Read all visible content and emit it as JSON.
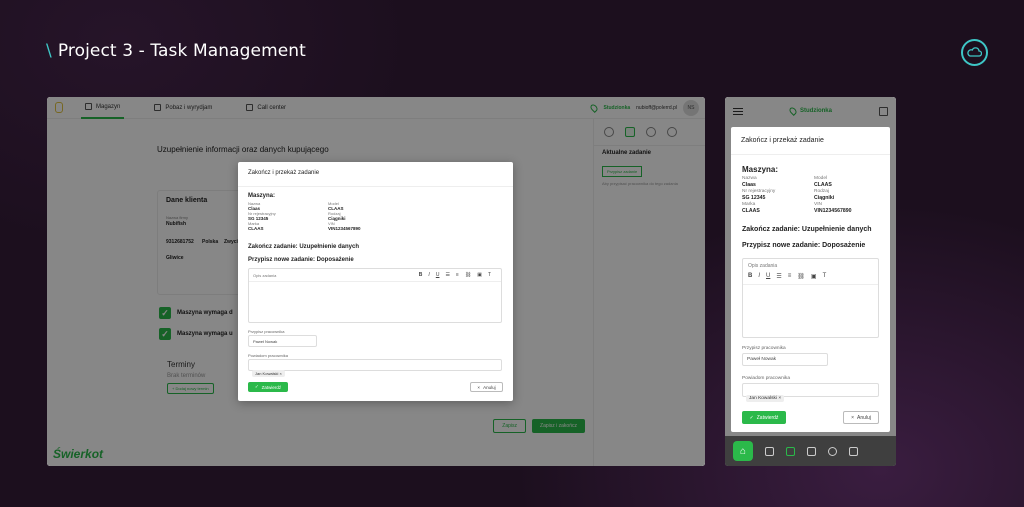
{
  "page_title": "Project 3 - Task Management",
  "slash": "\\",
  "icons": {
    "cloud": "cloud-logo-icon"
  },
  "colors": {
    "accent": "#2bb94a",
    "background": "#1c0f1e",
    "title_accent": "#3ec6c6"
  },
  "desktop": {
    "nav": {
      "items": [
        {
          "label": "Magazyn",
          "icon": "home-icon"
        },
        {
          "label": "Pobaz i wyrydjam",
          "icon": "truck-icon"
        },
        {
          "label": "Call center",
          "icon": "phone-icon"
        }
      ],
      "location": "Studzionka",
      "email": "nubioff@polerrd.pl",
      "avatar": "NS"
    },
    "section_title": "Uzupełnienie informacji oraz danych kupującego",
    "buyer_card_title": "Dane klienta",
    "buyer": {
      "name_label": "Nazwa firmy",
      "name": "Nubifish",
      "nip": "9312681752",
      "country": "Polska",
      "city": "Zwycie",
      "address": "Gliwice"
    },
    "checks": [
      "Maszyna wymaga d",
      "Maszyna wymaga u"
    ],
    "terms_title": "Terminy",
    "terms_empty": "Brak terminów",
    "add_term": "+ Dodaj nowy termin",
    "right": {
      "title": "Aktualne zadanie",
      "task_btn": "Przypisz zadanie",
      "note": "Aby przypisać pracownika do tego zadania"
    },
    "btn_save": "Zapisz",
    "btn_save_close": "Zapisz i zakończ",
    "brand": "Świerkot"
  },
  "dialog": {
    "title": "Zakończ i przekaż zadanie",
    "machine_title": "Maszyna:",
    "fields": [
      {
        "k": "Nazwa",
        "v": "Claas"
      },
      {
        "k": "Model",
        "v": "CLAAS"
      },
      {
        "k": "Nr rejestracyjny",
        "v": "SG 12345"
      },
      {
        "k": "Rodzaj",
        "v": "Ciągniki"
      },
      {
        "k": "Marka",
        "v": "CLAAS"
      },
      {
        "k": "VIN",
        "v": "VIN1234567890"
      }
    ],
    "finish_task": "Zakończ zadanie: Uzupełnienie danych",
    "assign_task": "Przypisz nowe zadanie: Doposażenie",
    "editor_placeholder": "Opis zadania",
    "assign_worker_label": "Przypisz pracownika",
    "assign_worker_value": "Paweł Nowak",
    "notify_label": "Powiadom pracownika",
    "notify_chip": "Jan Kowalski",
    "confirm": "Zatwierdź",
    "cancel": "Anuluj"
  },
  "mobile": {
    "location": "Studzionka"
  }
}
